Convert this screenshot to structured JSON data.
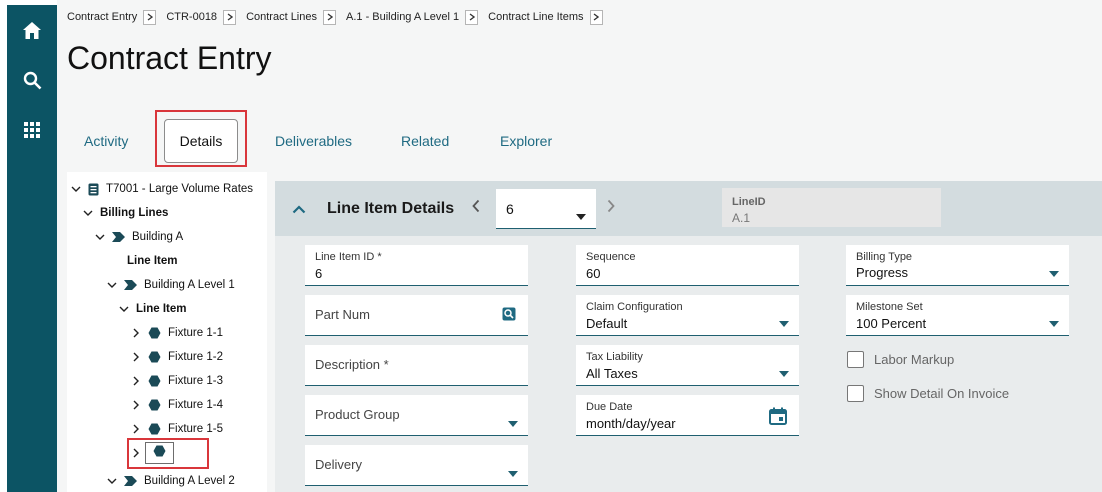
{
  "breadcrumb": [
    "Contract Entry",
    "CTR-0018",
    "Contract Lines",
    "A.1 - Building A Level 1",
    "Contract Line Items"
  ],
  "page_title": "Contract Entry",
  "tabs": {
    "activity": "Activity",
    "details": "Details",
    "deliverables": "Deliverables",
    "related": "Related",
    "explorer": "Explorer"
  },
  "tree": {
    "root": "T7001 - Large Volume Rates",
    "billing_lines": "Billing Lines",
    "building_a": "Building A",
    "line_item_1": "Line Item",
    "building_a_level_1": "Building A Level 1",
    "line_item_2": "Line Item",
    "fixtures": [
      "Fixture 1-1",
      "Fixture 1-2",
      "Fixture 1-3",
      "Fixture 1-4",
      "Fixture 1-5"
    ],
    "building_a_level_2": "Building A Level 2"
  },
  "panel": {
    "title": "Line Item Details",
    "nav_value": "6",
    "lineid_label": "LineID",
    "lineid_value": "A.1"
  },
  "fields": {
    "line_item_id": {
      "label": "Line Item ID *",
      "value": "6"
    },
    "part_num": {
      "placeholder": "Part Num"
    },
    "description": {
      "placeholder": "Description *"
    },
    "product_group": {
      "placeholder": "Product Group"
    },
    "delivery": {
      "placeholder": "Delivery"
    },
    "sequence": {
      "label": "Sequence",
      "value": "60"
    },
    "claim_configuration": {
      "label": "Claim Configuration",
      "value": "Default"
    },
    "tax_liability": {
      "label": "Tax Liability",
      "value": "All Taxes"
    },
    "due_date": {
      "label": "Due Date",
      "value": "month/day/year"
    },
    "billing_type": {
      "label": "Billing Type",
      "value": "Progress"
    },
    "milestone_set": {
      "label": "Milestone Set",
      "value": "100 Percent"
    },
    "labor_markup": {
      "label": "Labor Markup",
      "checked": false
    },
    "show_detail_on_invoice": {
      "label": "Show Detail On Invoice",
      "checked": false
    }
  },
  "colors": {
    "rail": "#0c5464",
    "accent": "#1f6a82",
    "highlight": "#d9363b",
    "panel_header": "#d3dcdf"
  },
  "icons": [
    "home-icon",
    "search-icon",
    "apps-grid-icon",
    "chevron-right-icon",
    "chevron-down-icon",
    "chevron-up-icon",
    "contract-icon",
    "tag-icon",
    "hexagon-icon",
    "part-search-icon",
    "calendar-icon"
  ]
}
